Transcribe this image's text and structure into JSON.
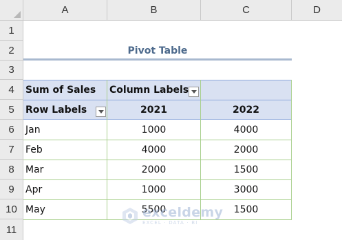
{
  "columns": [
    "A",
    "B",
    "C",
    "D"
  ],
  "rows": [
    "1",
    "2",
    "3",
    "4",
    "5",
    "6",
    "7",
    "8",
    "9",
    "10",
    "11"
  ],
  "title": "Pivot Table",
  "pivot": {
    "corner_label": "Sum of Sales",
    "column_labels": "Column Labels",
    "row_labels": "Row Labels",
    "years": [
      "2021",
      "2022"
    ],
    "records": [
      {
        "month": "Jan",
        "v2021": "1000",
        "v2022": "4000"
      },
      {
        "month": "Feb",
        "v2021": "4000",
        "v2022": "2000"
      },
      {
        "month": "Mar",
        "v2021": "2000",
        "v2022": "1500"
      },
      {
        "month": "Apr",
        "v2021": "1000",
        "v2022": "3000"
      },
      {
        "month": "May",
        "v2021": "5500",
        "v2022": "1500"
      }
    ]
  },
  "watermark": {
    "name": "exceldemy",
    "tagline": "EXCEL · DATA · BI"
  },
  "colors": {
    "pivot_header_fill": "#d9e1f2",
    "title_color": "#4d6a8c",
    "grid_line": "#a9d08e"
  }
}
